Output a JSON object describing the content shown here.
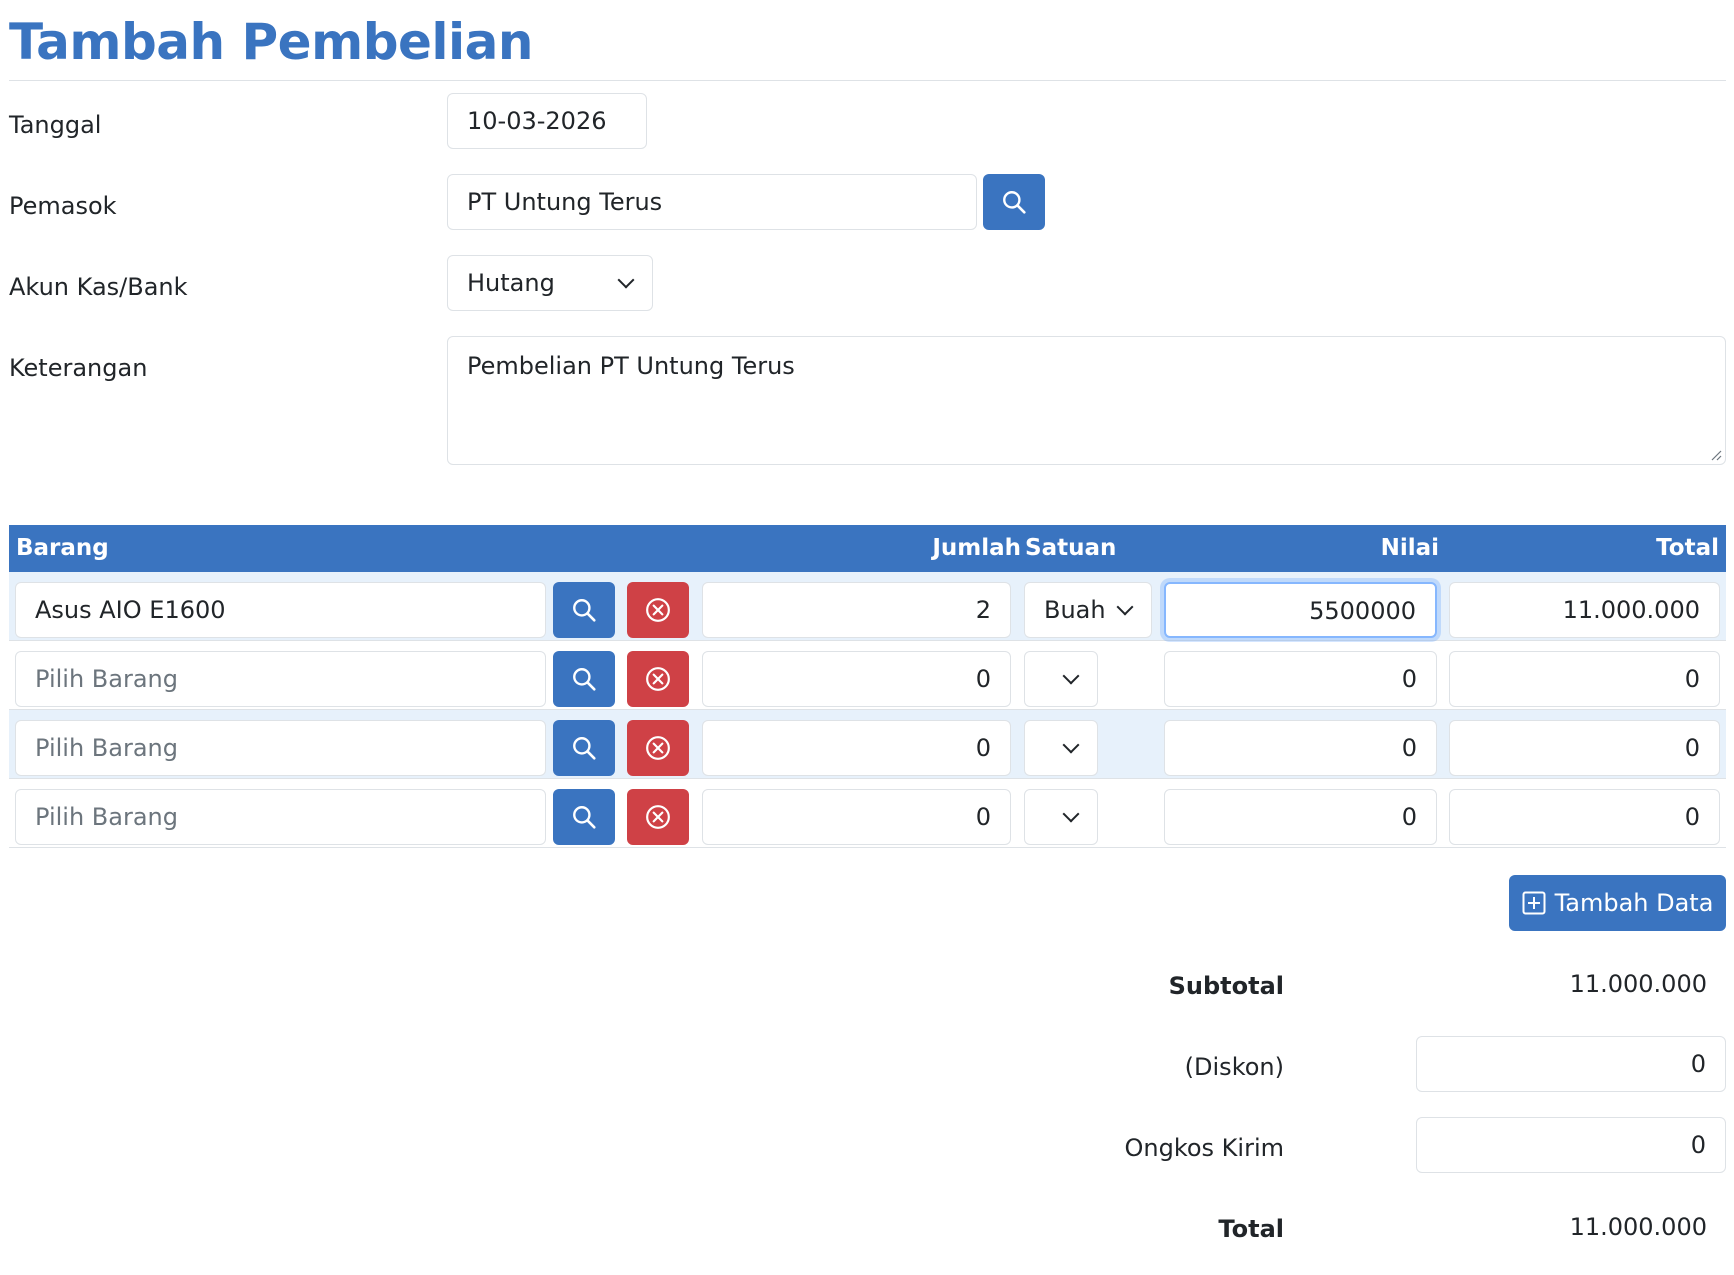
{
  "page": {
    "title": "Tambah Pembelian"
  },
  "form": {
    "tanggal": {
      "label": "Tanggal",
      "value": "10-03-2026"
    },
    "pemasok": {
      "label": "Pemasok",
      "value": "PT Untung Terus"
    },
    "akun": {
      "label": "Akun Kas/Bank",
      "selected": "Hutang"
    },
    "keterangan": {
      "label": "Keterangan",
      "value": "Pembelian PT Untung Terus"
    }
  },
  "table": {
    "headers": {
      "barang": "Barang",
      "jumlah": "Jumlah",
      "satuan": "Satuan",
      "nilai": "Nilai",
      "total": "Total"
    },
    "rows": [
      {
        "barang": "Asus AIO E1600",
        "jumlah": "2",
        "satuan": "Buah",
        "nilai": "5500000",
        "total": "11.000.000"
      },
      {
        "barang_placeholder": "Pilih Barang",
        "jumlah": "0",
        "satuan": "",
        "nilai": "0",
        "total": "0"
      },
      {
        "barang_placeholder": "Pilih Barang",
        "jumlah": "0",
        "satuan": "",
        "nilai": "0",
        "total": "0"
      },
      {
        "barang_placeholder": "Pilih Barang",
        "jumlah": "0",
        "satuan": "",
        "nilai": "0",
        "total": "0"
      }
    ]
  },
  "actions": {
    "add_label": "Tambah Data"
  },
  "summary": {
    "subtotal_label": "Subtotal",
    "subtotal_value": "11.000.000",
    "diskon_label": "(Diskon)",
    "diskon_value": "0",
    "ongkir_label": "Ongkos Kirim",
    "ongkir_value": "0",
    "total_label": "Total",
    "total_value": "11.000.000"
  },
  "colors": {
    "primary": "#3a74c0",
    "danger": "#cf4146",
    "stripe": "#e7f1fb",
    "border": "#dee2e6"
  },
  "icons": {
    "search": "search-icon",
    "remove": "x-circle-icon",
    "add": "plus-square-icon",
    "dropdown": "chevron-down-icon"
  }
}
